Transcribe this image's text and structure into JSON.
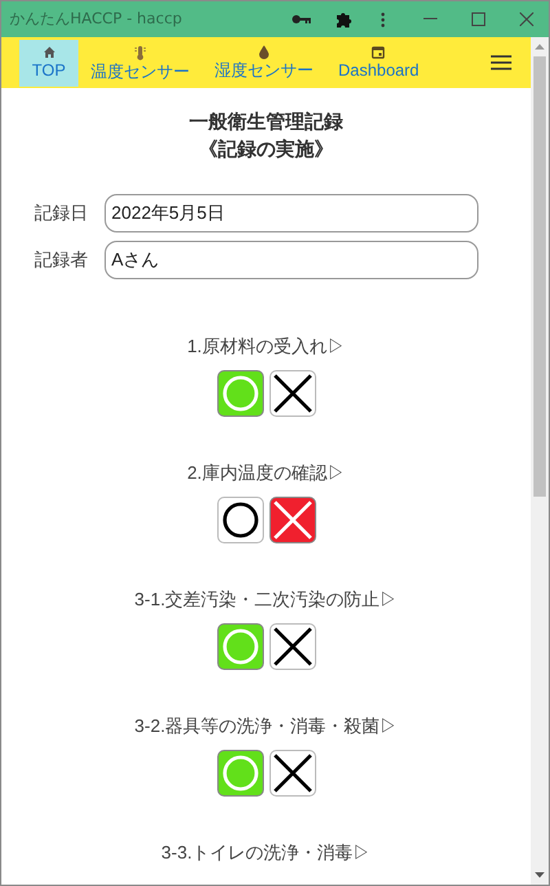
{
  "window": {
    "title": "かんたんHACCP - haccp"
  },
  "nav": [
    {
      "label": "TOP",
      "kind": "home",
      "selected": true
    },
    {
      "label": "温度センサー",
      "kind": "thermometer",
      "selected": false
    },
    {
      "label": "湿度センサー",
      "kind": "drop",
      "selected": false
    },
    {
      "label": "Dashboard",
      "kind": "calendar",
      "selected": false
    }
  ],
  "heading": [
    "一般衛生管理記録",
    "《記録の実施》"
  ],
  "fields": [
    {
      "label": "記録日",
      "value": "2022年5月5日"
    },
    {
      "label": "記録者",
      "value": "Aさん"
    }
  ],
  "items": [
    {
      "label": "1.原材料の受入れ▷",
      "buttons": [
        {
          "kind": "circle",
          "selected": true
        },
        {
          "kind": "cross",
          "selected": false
        }
      ]
    },
    {
      "label": "2.庫内温度の確認▷",
      "buttons": [
        {
          "kind": "circle",
          "selected": false
        },
        {
          "kind": "cross",
          "selected": true
        }
      ]
    },
    {
      "label": "3-1.交差汚染・二次汚染の防止▷",
      "buttons": [
        {
          "kind": "circle",
          "selected": true
        },
        {
          "kind": "cross",
          "selected": false
        }
      ]
    },
    {
      "label": "3-2.器具等の洗浄・消毒・殺菌▷",
      "buttons": [
        {
          "kind": "circle",
          "selected": true
        },
        {
          "kind": "cross",
          "selected": false
        }
      ]
    },
    {
      "label": "3-3.トイレの洗浄・消毒▷"
    }
  ]
}
